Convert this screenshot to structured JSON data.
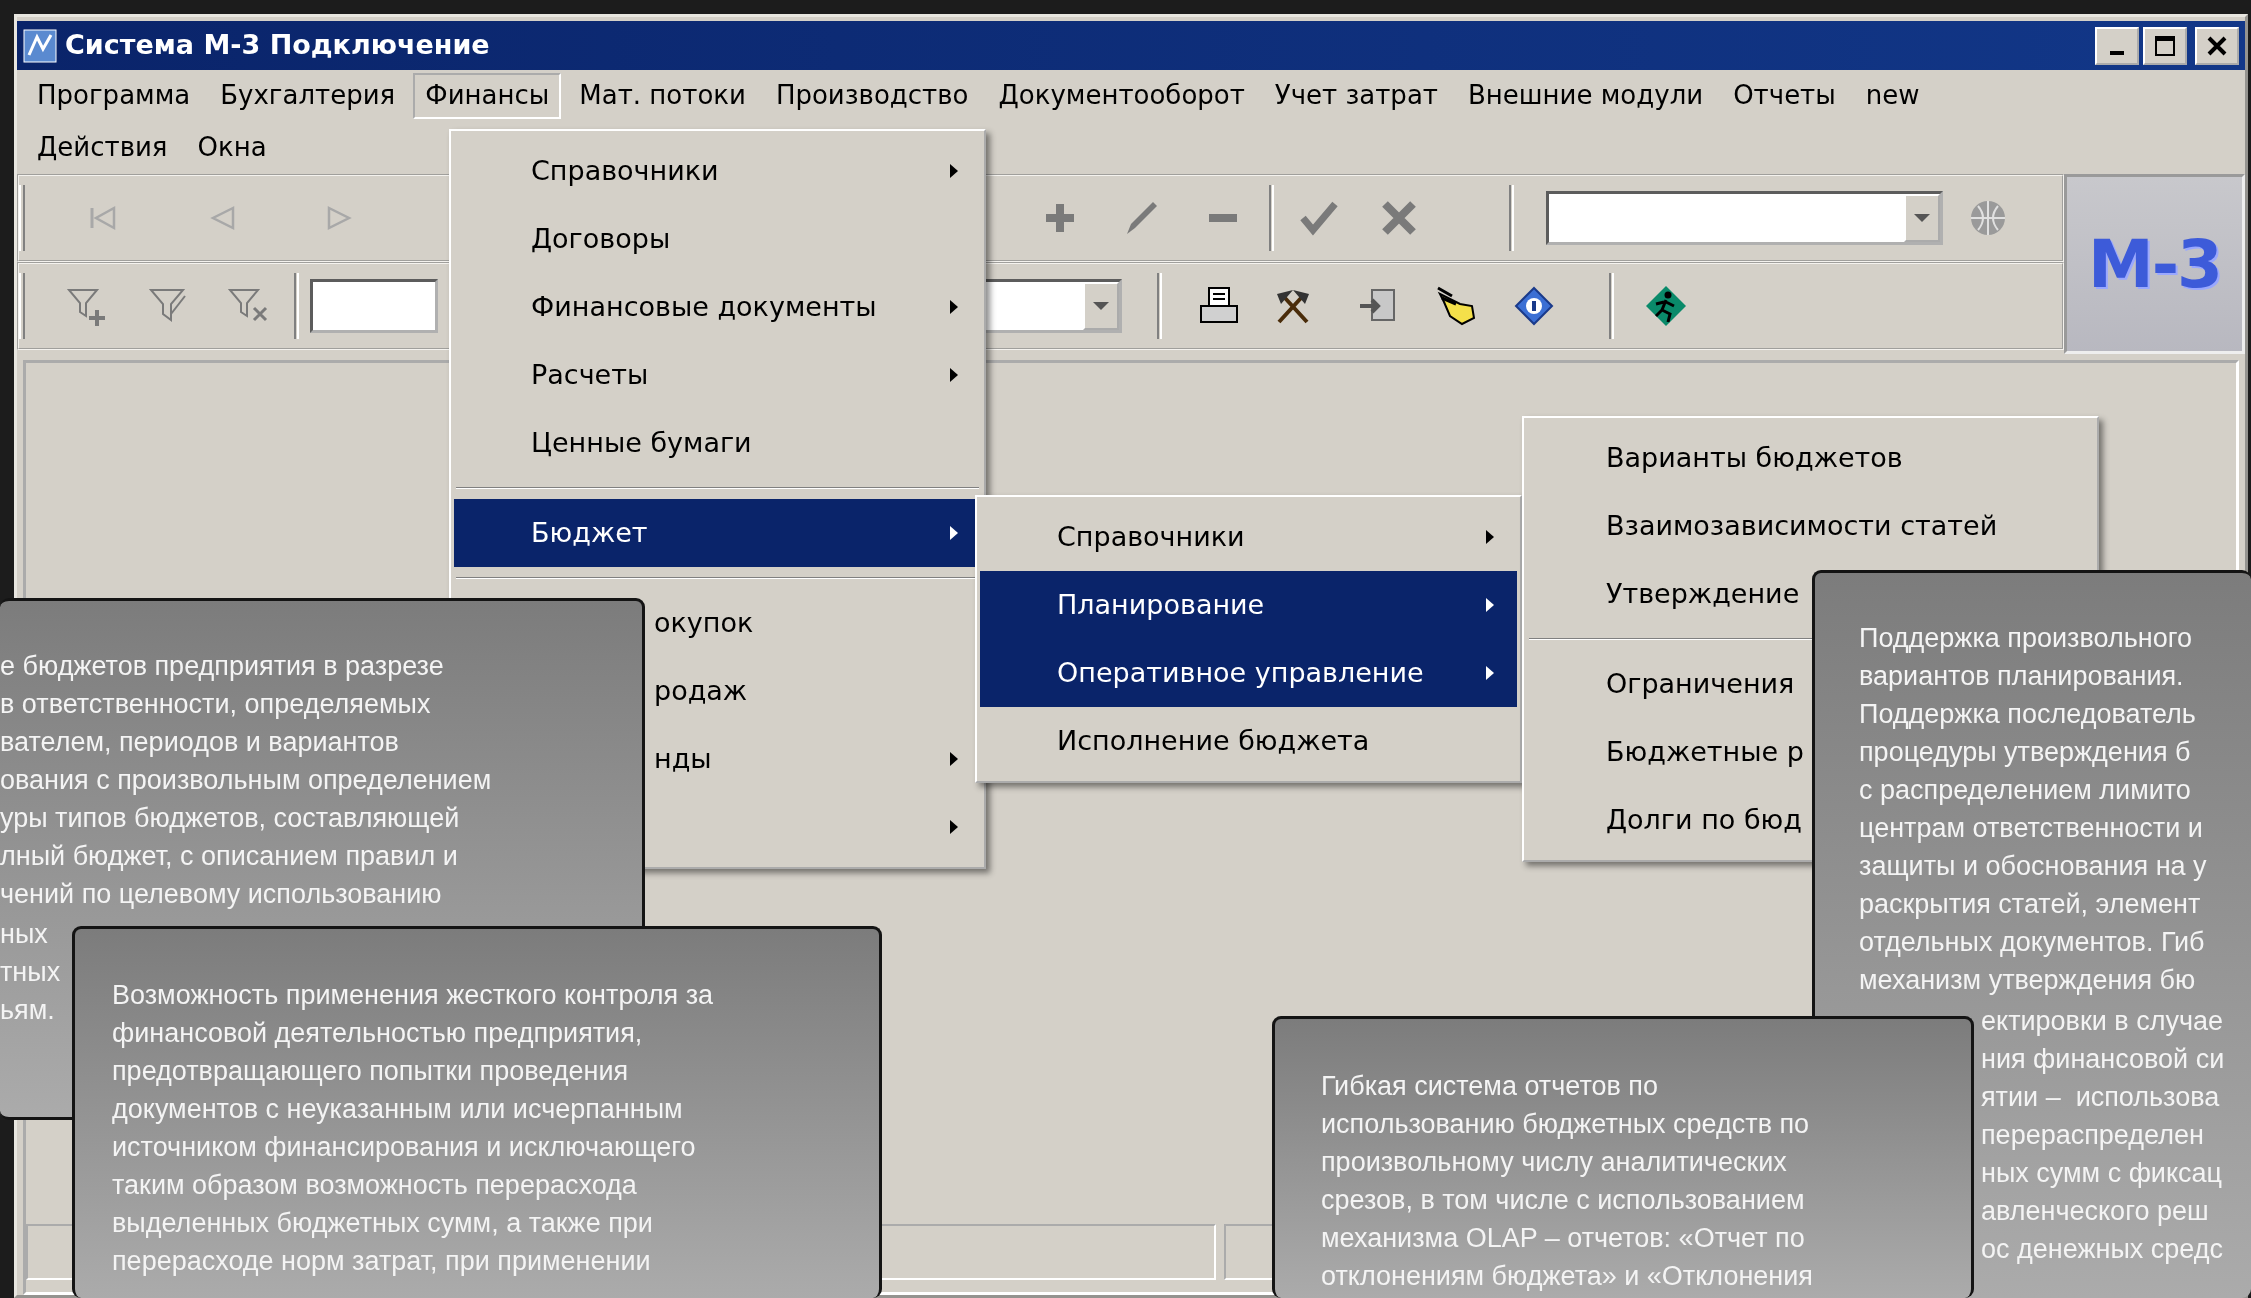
{
  "window": {
    "title": "Система М-3 Подключение"
  },
  "menu_bar": [
    {
      "items": [
        {
          "label": "Программа",
          "selected": false
        },
        {
          "label": "Бухгалтерия",
          "selected": false
        },
        {
          "label": "Финансы",
          "selected": true
        },
        {
          "label": "Мат. потоки",
          "selected": false
        },
        {
          "label": "Производство",
          "selected": false
        },
        {
          "label": "Документооборот",
          "selected": false
        },
        {
          "label": "Учет затрат",
          "selected": false
        },
        {
          "label": "Внешние модули",
          "selected": false
        },
        {
          "label": "Отчеты",
          "selected": false
        },
        {
          "label": "new",
          "selected": false
        }
      ]
    },
    {
      "items": [
        {
          "label": "Действия",
          "selected": false
        },
        {
          "label": "Окна",
          "selected": false
        }
      ]
    }
  ],
  "logo": "М-3",
  "finance_menu": [
    {
      "kind": "item",
      "label": "Справочники",
      "submenu": true,
      "selected": false
    },
    {
      "kind": "item",
      "label": "Договоры",
      "submenu": false,
      "selected": false
    },
    {
      "kind": "item",
      "label": "Финансовые документы",
      "submenu": true,
      "selected": false
    },
    {
      "kind": "item",
      "label": "Расчеты",
      "submenu": true,
      "selected": false
    },
    {
      "kind": "item",
      "label": "Ценные бумаги",
      "submenu": false,
      "selected": false
    },
    {
      "kind": "separator"
    },
    {
      "kind": "item",
      "label": "Бюджет",
      "submenu": true,
      "selected": true
    },
    {
      "kind": "separator"
    },
    {
      "kind": "clipped",
      "label": "окупок",
      "submenu": false,
      "selected": false
    },
    {
      "kind": "clipped",
      "label": "родаж",
      "submenu": false,
      "selected": false
    },
    {
      "kind": "clipped",
      "label": "нды",
      "submenu": true,
      "selected": false
    },
    {
      "kind": "clipped",
      "submenu": true,
      "selected": false
    }
  ],
  "budget_menu": [
    {
      "kind": "item",
      "label": "Справочники",
      "submenu": true,
      "selected": false
    },
    {
      "kind": "item",
      "label": "Планирование",
      "submenu": true,
      "selected": true
    },
    {
      "kind": "item",
      "label": "Оперативное управление",
      "submenu": true,
      "selected": true
    },
    {
      "kind": "item",
      "label": "Исполнение бюджета",
      "submenu": false,
      "selected": false
    }
  ],
  "planning_menu": [
    {
      "kind": "item",
      "label": "Варианты бюджетов",
      "submenu": false,
      "selected": false
    },
    {
      "kind": "item",
      "label": "Взаимозависимости статей",
      "submenu": false,
      "selected": false
    },
    {
      "kind": "item",
      "label": "Утверждение",
      "submenu": false,
      "selected": false
    },
    {
      "kind": "separator"
    },
    {
      "kind": "item",
      "label": "Ограничения",
      "submenu": false,
      "selected": false
    },
    {
      "kind": "item",
      "label": "Бюджетные р",
      "submenu": false,
      "selected": false
    },
    {
      "kind": "item",
      "label": "Долги по бюд",
      "submenu": false,
      "selected": false
    }
  ],
  "callouts": [
    {
      "blocks": [
        "е бюджетов предприятия в разрезе\nв ответственности, определяемых\nвателем, периодов и вариантов\nования с произвольным определением\nуры типов бюджетов, составляющей\nлный бюджет, с описанием правил и\nчений по целевому использованию",
        "ных\nтных\nьям."
      ]
    },
    {
      "blocks": [
        "Возможность применения жесткого контроля за\nфинансовой деятельностью предприятия,\nпредотвращающего попытки проведения\nдокументов с неуказанным или исчерпанным\nисточником финансирования и исключающего\nтаким образом возможность перерасхода\nвыделенных бюджетных сумм, а также при\nперерасходе норм затрат, при применении"
      ]
    },
    {
      "blocks": [
        "Поддержка произвольного\nвариантов планирования.\nПоддержка последователь\nпроцедуры утверждения б\nс распределением лимито\nцентрам ответственности и\nзащиты и обоснования на у\nраскрытия статей, элемент\nотдельных документов. Гиб\nмеханизм утверждения бю",
        "ектировки в случае\nния финансовой си\nятии –  использова\nперераспределен\nных сумм с фиксац\nавленческого реш\nос денежных средс"
      ]
    },
    {
      "blocks": [
        "Гибкая система отчетов по\nиспользованию бюджетных средств по\nпроизвольному числу аналитических\nсрезов, в том числе с использованием\nмеханизма OLAP – отчетов: «Отчет по\nотклонениям бюджета» и «Отклонения"
      ]
    }
  ]
}
